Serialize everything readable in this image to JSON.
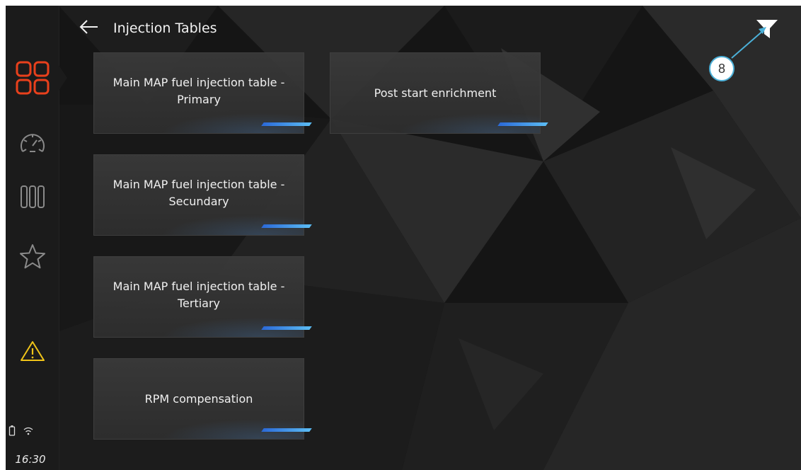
{
  "header": {
    "title": "Injection Tables",
    "back_icon": "arrow-left-icon"
  },
  "sidebar": {
    "items": [
      {
        "name": "dashboard",
        "icon": "grid-icon",
        "color": "#e8401c",
        "active": true
      },
      {
        "name": "gauges",
        "icon": "speedometer-icon",
        "color": "#8a8a8a",
        "active": false
      },
      {
        "name": "bars",
        "icon": "bar-columns-icon",
        "color": "#8a8a8a",
        "active": false
      },
      {
        "name": "favorites",
        "icon": "star-icon",
        "color": "#8a8a8a",
        "active": false
      },
      {
        "name": "warnings",
        "icon": "warning-icon",
        "color": "#f0c419",
        "active": false
      }
    ],
    "status": {
      "battery_icon": "battery-icon",
      "wifi_icon": "wifi-icon"
    },
    "clock": "16:30"
  },
  "tables": [
    {
      "label_line1": "Main MAP fuel injection table -",
      "label_line2": "Primary"
    },
    {
      "label_line1": "Post start enrichment",
      "label_line2": ""
    },
    {
      "label_line1": "Main MAP fuel injection table -",
      "label_line2": "Secundary"
    },
    {
      "label_line1": "Main MAP fuel injection table -",
      "label_line2": "Tertiary"
    },
    {
      "label_line1": "RPM compensation",
      "label_line2": ""
    }
  ],
  "filter": {
    "icon": "filter-icon"
  },
  "callout": {
    "label": "8",
    "color": "#4bb0d8"
  },
  "colors": {
    "accent_blue": "#4aa6ee",
    "background": "#151515",
    "card": "#353535"
  }
}
